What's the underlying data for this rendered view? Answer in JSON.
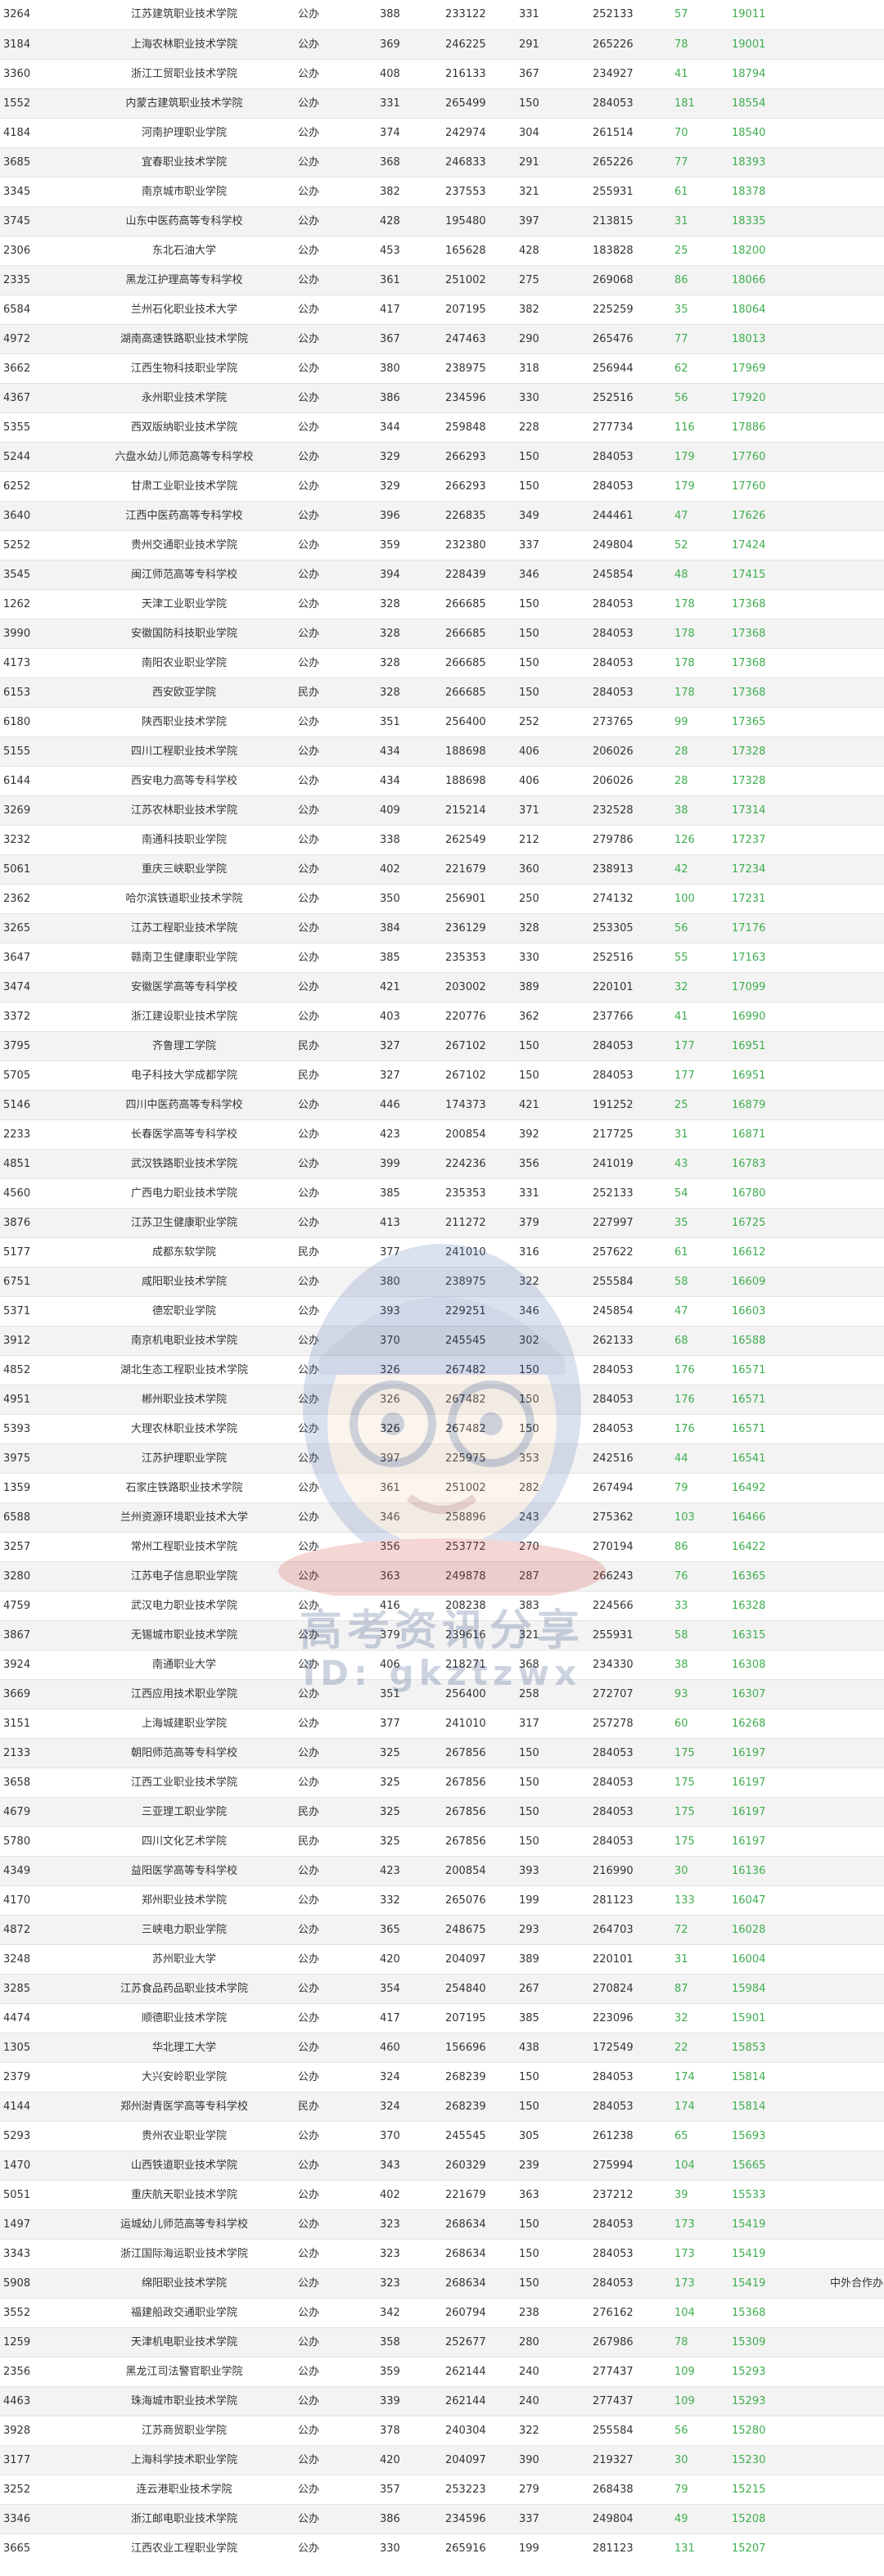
{
  "rows": [
    [
      "3264",
      "江苏建筑职业技术学院",
      "公办",
      "388",
      "233122",
      "331",
      "252133",
      "57",
      "19011",
      ""
    ],
    [
      "3184",
      "上海农林职业技术学院",
      "公办",
      "369",
      "246225",
      "291",
      "265226",
      "78",
      "19001",
      ""
    ],
    [
      "3360",
      "浙江工贸职业技术学院",
      "公办",
      "408",
      "216133",
      "367",
      "234927",
      "41",
      "18794",
      ""
    ],
    [
      "1552",
      "内蒙古建筑职业技术学院",
      "公办",
      "331",
      "265499",
      "150",
      "284053",
      "181",
      "18554",
      ""
    ],
    [
      "4184",
      "河南护理职业学院",
      "公办",
      "374",
      "242974",
      "304",
      "261514",
      "70",
      "18540",
      ""
    ],
    [
      "3685",
      "宜春职业技术学院",
      "公办",
      "368",
      "246833",
      "291",
      "265226",
      "77",
      "18393",
      ""
    ],
    [
      "3345",
      "南京城市职业学院",
      "公办",
      "382",
      "237553",
      "321",
      "255931",
      "61",
      "18378",
      ""
    ],
    [
      "3745",
      "山东中医药高等专科学校",
      "公办",
      "428",
      "195480",
      "397",
      "213815",
      "31",
      "18335",
      ""
    ],
    [
      "2306",
      "东北石油大学",
      "公办",
      "453",
      "165628",
      "428",
      "183828",
      "25",
      "18200",
      ""
    ],
    [
      "2335",
      "黑龙江护理高等专科学校",
      "公办",
      "361",
      "251002",
      "275",
      "269068",
      "86",
      "18066",
      ""
    ],
    [
      "6584",
      "兰州石化职业技术大学",
      "公办",
      "417",
      "207195",
      "382",
      "225259",
      "35",
      "18064",
      ""
    ],
    [
      "4972",
      "湖南高速铁路职业技术学院",
      "公办",
      "367",
      "247463",
      "290",
      "265476",
      "77",
      "18013",
      ""
    ],
    [
      "3662",
      "江西生物科技职业学院",
      "公办",
      "380",
      "238975",
      "318",
      "256944",
      "62",
      "17969",
      ""
    ],
    [
      "4367",
      "永州职业技术学院",
      "公办",
      "386",
      "234596",
      "330",
      "252516",
      "56",
      "17920",
      ""
    ],
    [
      "5355",
      "西双版纳职业技术学院",
      "公办",
      "344",
      "259848",
      "228",
      "277734",
      "116",
      "17886",
      ""
    ],
    [
      "5244",
      "六盘水幼儿师范高等专科学校",
      "公办",
      "329",
      "266293",
      "150",
      "284053",
      "179",
      "17760",
      ""
    ],
    [
      "6252",
      "甘肃工业职业技术学院",
      "公办",
      "329",
      "266293",
      "150",
      "284053",
      "179",
      "17760",
      ""
    ],
    [
      "3640",
      "江西中医药高等专科学校",
      "公办",
      "396",
      "226835",
      "349",
      "244461",
      "47",
      "17626",
      ""
    ],
    [
      "5252",
      "贵州交通职业技术学院",
      "公办",
      "359",
      "232380",
      "337",
      "249804",
      "52",
      "17424",
      ""
    ],
    [
      "3545",
      "闽江师范高等专科学校",
      "公办",
      "394",
      "228439",
      "346",
      "245854",
      "48",
      "17415",
      ""
    ],
    [
      "1262",
      "天津工业职业学院",
      "公办",
      "328",
      "266685",
      "150",
      "284053",
      "178",
      "17368",
      ""
    ],
    [
      "3990",
      "安徽国防科技职业学院",
      "公办",
      "328",
      "266685",
      "150",
      "284053",
      "178",
      "17368",
      ""
    ],
    [
      "4173",
      "南阳农业职业学院",
      "公办",
      "328",
      "266685",
      "150",
      "284053",
      "178",
      "17368",
      ""
    ],
    [
      "6153",
      "西安欧亚学院",
      "民办",
      "328",
      "266685",
      "150",
      "284053",
      "178",
      "17368",
      ""
    ],
    [
      "6180",
      "陕西职业技术学院",
      "公办",
      "351",
      "256400",
      "252",
      "273765",
      "99",
      "17365",
      ""
    ],
    [
      "5155",
      "四川工程职业技术学院",
      "公办",
      "434",
      "188698",
      "406",
      "206026",
      "28",
      "17328",
      ""
    ],
    [
      "6144",
      "西安电力高等专科学校",
      "公办",
      "434",
      "188698",
      "406",
      "206026",
      "28",
      "17328",
      ""
    ],
    [
      "3269",
      "江苏农林职业技术学院",
      "公办",
      "409",
      "215214",
      "371",
      "232528",
      "38",
      "17314",
      ""
    ],
    [
      "3232",
      "南通科技职业学院",
      "公办",
      "338",
      "262549",
      "212",
      "279786",
      "126",
      "17237",
      ""
    ],
    [
      "5061",
      "重庆三峡职业学院",
      "公办",
      "402",
      "221679",
      "360",
      "238913",
      "42",
      "17234",
      ""
    ],
    [
      "2362",
      "哈尔滨铁道职业技术学院",
      "公办",
      "350",
      "256901",
      "250",
      "274132",
      "100",
      "17231",
      ""
    ],
    [
      "3265",
      "江苏工程职业技术学院",
      "公办",
      "384",
      "236129",
      "328",
      "253305",
      "56",
      "17176",
      ""
    ],
    [
      "3647",
      "赣南卫生健康职业学院",
      "公办",
      "385",
      "235353",
      "330",
      "252516",
      "55",
      "17163",
      ""
    ],
    [
      "3474",
      "安徽医学高等专科学校",
      "公办",
      "421",
      "203002",
      "389",
      "220101",
      "32",
      "17099",
      ""
    ],
    [
      "3372",
      "浙江建设职业技术学院",
      "公办",
      "403",
      "220776",
      "362",
      "237766",
      "41",
      "16990",
      ""
    ],
    [
      "3795",
      "齐鲁理工学院",
      "民办",
      "327",
      "267102",
      "150",
      "284053",
      "177",
      "16951",
      ""
    ],
    [
      "5705",
      "电子科技大学成都学院",
      "民办",
      "327",
      "267102",
      "150",
      "284053",
      "177",
      "16951",
      ""
    ],
    [
      "5146",
      "四川中医药高等专科学校",
      "公办",
      "446",
      "174373",
      "421",
      "191252",
      "25",
      "16879",
      ""
    ],
    [
      "2233",
      "长春医学高等专科学校",
      "公办",
      "423",
      "200854",
      "392",
      "217725",
      "31",
      "16871",
      ""
    ],
    [
      "4851",
      "武汉铁路职业技术学院",
      "公办",
      "399",
      "224236",
      "356",
      "241019",
      "43",
      "16783",
      ""
    ],
    [
      "4560",
      "广西电力职业技术学院",
      "公办",
      "385",
      "235353",
      "331",
      "252133",
      "54",
      "16780",
      ""
    ],
    [
      "3876",
      "江苏卫生健康职业学院",
      "公办",
      "413",
      "211272",
      "379",
      "227997",
      "35",
      "16725",
      ""
    ],
    [
      "5177",
      "成都东软学院",
      "民办",
      "377",
      "241010",
      "316",
      "257622",
      "61",
      "16612",
      ""
    ],
    [
      "6751",
      "咸阳职业技术学院",
      "公办",
      "380",
      "238975",
      "322",
      "255584",
      "58",
      "16609",
      ""
    ],
    [
      "5371",
      "德宏职业学院",
      "公办",
      "393",
      "229251",
      "346",
      "245854",
      "47",
      "16603",
      ""
    ],
    [
      "3912",
      "南京机电职业技术学院",
      "公办",
      "370",
      "245545",
      "302",
      "262133",
      "68",
      "16588",
      ""
    ],
    [
      "4852",
      "湖北生态工程职业技术学院",
      "公办",
      "326",
      "267482",
      "150",
      "284053",
      "176",
      "16571",
      ""
    ],
    [
      "4951",
      "郴州职业技术学院",
      "公办",
      "326",
      "267482",
      "150",
      "284053",
      "176",
      "16571",
      ""
    ],
    [
      "5393",
      "大理农林职业技术学院",
      "公办",
      "326",
      "267482",
      "150",
      "284053",
      "176",
      "16571",
      ""
    ],
    [
      "3975",
      "江苏护理职业学院",
      "公办",
      "397",
      "225975",
      "353",
      "242516",
      "44",
      "16541",
      ""
    ],
    [
      "1359",
      "石家庄铁路职业技术学院",
      "公办",
      "361",
      "251002",
      "282",
      "267494",
      "79",
      "16492",
      ""
    ],
    [
      "6588",
      "兰州资源环境职业技术大学",
      "公办",
      "346",
      "258896",
      "243",
      "275362",
      "103",
      "16466",
      ""
    ],
    [
      "3257",
      "常州工程职业技术学院",
      "公办",
      "356",
      "253772",
      "270",
      "270194",
      "86",
      "16422",
      ""
    ],
    [
      "3280",
      "江苏电子信息职业学院",
      "公办",
      "363",
      "249878",
      "287",
      "266243",
      "76",
      "16365",
      ""
    ],
    [
      "4759",
      "武汉电力职业技术学院",
      "公办",
      "416",
      "208238",
      "383",
      "224566",
      "33",
      "16328",
      ""
    ],
    [
      "3867",
      "无锡城市职业技术学院",
      "公办",
      "379",
      "239616",
      "321",
      "255931",
      "58",
      "16315",
      ""
    ],
    [
      "3924",
      "南通职业大学",
      "公办",
      "406",
      "218271",
      "368",
      "234330",
      "38",
      "16308",
      ""
    ],
    [
      "3669",
      "江西应用技术职业学院",
      "公办",
      "351",
      "256400",
      "258",
      "272707",
      "93",
      "16307",
      ""
    ],
    [
      "3151",
      "上海城建职业学院",
      "公办",
      "377",
      "241010",
      "317",
      "257278",
      "60",
      "16268",
      ""
    ],
    [
      "2133",
      "朝阳师范高等专科学校",
      "公办",
      "325",
      "267856",
      "150",
      "284053",
      "175",
      "16197",
      ""
    ],
    [
      "3658",
      "江西工业职业技术学院",
      "公办",
      "325",
      "267856",
      "150",
      "284053",
      "175",
      "16197",
      ""
    ],
    [
      "4679",
      "三亚理工职业学院",
      "民办",
      "325",
      "267856",
      "150",
      "284053",
      "175",
      "16197",
      ""
    ],
    [
      "5780",
      "四川文化艺术学院",
      "民办",
      "325",
      "267856",
      "150",
      "284053",
      "175",
      "16197",
      ""
    ],
    [
      "4349",
      "益阳医学高等专科学校",
      "公办",
      "423",
      "200854",
      "393",
      "216990",
      "30",
      "16136",
      ""
    ],
    [
      "4170",
      "郑州职业技术学院",
      "公办",
      "332",
      "265076",
      "199",
      "281123",
      "133",
      "16047",
      ""
    ],
    [
      "4872",
      "三峡电力职业学院",
      "公办",
      "365",
      "248675",
      "293",
      "264703",
      "72",
      "16028",
      ""
    ],
    [
      "3248",
      "苏州职业大学",
      "公办",
      "420",
      "204097",
      "389",
      "220101",
      "31",
      "16004",
      ""
    ],
    [
      "3285",
      "江苏食品药品职业技术学院",
      "公办",
      "354",
      "254840",
      "267",
      "270824",
      "87",
      "15984",
      ""
    ],
    [
      "4474",
      "顺德职业技术学院",
      "公办",
      "417",
      "207195",
      "385",
      "223096",
      "32",
      "15901",
      ""
    ],
    [
      "1305",
      "华北理工大学",
      "公办",
      "460",
      "156696",
      "438",
      "172549",
      "22",
      "15853",
      ""
    ],
    [
      "2379",
      "大兴安岭职业学院",
      "公办",
      "324",
      "268239",
      "150",
      "284053",
      "174",
      "15814",
      ""
    ],
    [
      "4144",
      "郑州澍青医学高等专科学校",
      "民办",
      "324",
      "268239",
      "150",
      "284053",
      "174",
      "15814",
      ""
    ],
    [
      "5293",
      "贵州农业职业学院",
      "公办",
      "370",
      "245545",
      "305",
      "261238",
      "65",
      "15693",
      ""
    ],
    [
      "1470",
      "山西铁道职业技术学院",
      "公办",
      "343",
      "260329",
      "239",
      "275994",
      "104",
      "15665",
      ""
    ],
    [
      "5051",
      "重庆航天职业技术学院",
      "公办",
      "402",
      "221679",
      "363",
      "237212",
      "39",
      "15533",
      ""
    ],
    [
      "1497",
      "运城幼儿师范高等专科学校",
      "公办",
      "323",
      "268634",
      "150",
      "284053",
      "173",
      "15419",
      ""
    ],
    [
      "3343",
      "浙江国际海运职业技术学院",
      "公办",
      "323",
      "268634",
      "150",
      "284053",
      "173",
      "15419",
      ""
    ],
    [
      "5908",
      "绵阳职业技术学院",
      "公办",
      "323",
      "268634",
      "150",
      "284053",
      "173",
      "15419",
      "中外合作办学"
    ],
    [
      "3552",
      "福建船政交通职业学院",
      "公办",
      "342",
      "260794",
      "238",
      "276162",
      "104",
      "15368",
      ""
    ],
    [
      "1259",
      "天津机电职业技术学院",
      "公办",
      "358",
      "252677",
      "280",
      "267986",
      "78",
      "15309",
      ""
    ],
    [
      "2356",
      "黑龙江司法警官职业学院",
      "公办",
      "359",
      "262144",
      "240",
      "277437",
      "109",
      "15293",
      ""
    ],
    [
      "4463",
      "珠海城市职业技术学院",
      "公办",
      "339",
      "262144",
      "240",
      "277437",
      "109",
      "15293",
      ""
    ],
    [
      "3928",
      "江苏商贸职业学院",
      "公办",
      "378",
      "240304",
      "322",
      "255584",
      "56",
      "15280",
      ""
    ],
    [
      "3177",
      "上海科学技术职业学院",
      "公办",
      "420",
      "204097",
      "390",
      "219327",
      "30",
      "15230",
      ""
    ],
    [
      "3252",
      "连云港职业技术学院",
      "公办",
      "357",
      "253223",
      "279",
      "268438",
      "79",
      "15215",
      ""
    ],
    [
      "3346",
      "浙江邮电职业技术学院",
      "公办",
      "386",
      "234596",
      "337",
      "249804",
      "49",
      "15208",
      ""
    ],
    [
      "3665",
      "江西农业工程职业学院",
      "公办",
      "330",
      "265916",
      "199",
      "281123",
      "131",
      "15207",
      ""
    ]
  ],
  "watermark": {
    "title": "高考资讯分享",
    "subtitle": "ID: gkztzwx"
  }
}
